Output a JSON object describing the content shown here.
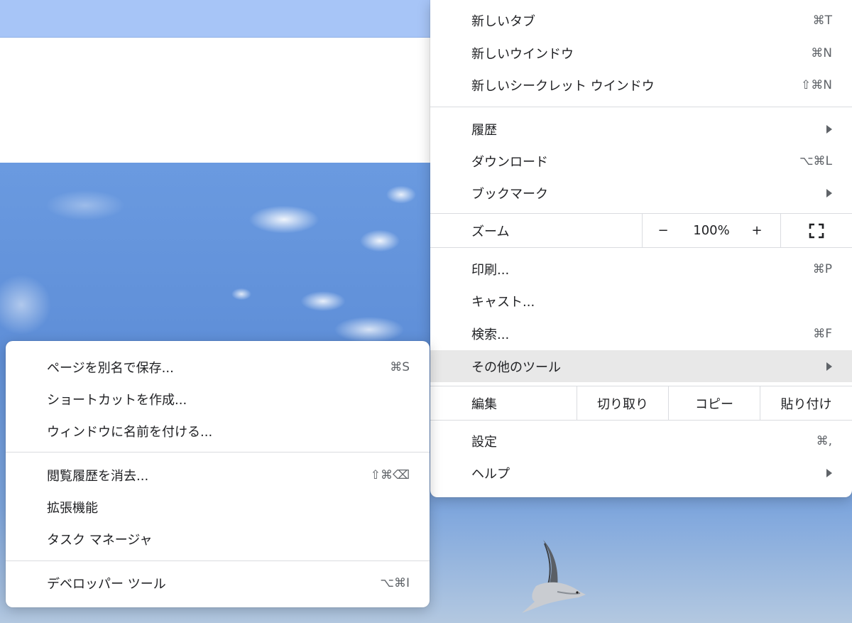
{
  "main_menu": {
    "items": [
      {
        "label": "新しいタブ",
        "shortcut": "⌘T"
      },
      {
        "label": "新しいウインドウ",
        "shortcut": "⌘N"
      },
      {
        "label": "新しいシークレット ウインドウ",
        "shortcut": "⇧⌘N"
      },
      {
        "label": "履歴",
        "shortcut": ""
      },
      {
        "label": "ダウンロード",
        "shortcut": "⌥⌘L"
      },
      {
        "label": "ブックマーク",
        "shortcut": ""
      },
      {
        "label": "印刷...",
        "shortcut": "⌘P"
      },
      {
        "label": "キャスト...",
        "shortcut": ""
      },
      {
        "label": "検索...",
        "shortcut": "⌘F"
      },
      {
        "label": "その他のツール",
        "shortcut": ""
      },
      {
        "label": "設定",
        "shortcut": "⌘,"
      },
      {
        "label": "ヘルプ",
        "shortcut": ""
      }
    ],
    "zoom": {
      "label": "ズーム",
      "minus": "−",
      "value": "100%",
      "plus": "+",
      "fullscreen_icon": "fullscreen-icon"
    },
    "edit": {
      "label": "編集",
      "cut": "切り取り",
      "copy": "コピー",
      "paste": "貼り付け"
    }
  },
  "sub_menu": {
    "items": [
      {
        "label": "ページを別名で保存...",
        "shortcut": "⌘S"
      },
      {
        "label": "ショートカットを作成...",
        "shortcut": ""
      },
      {
        "label": "ウィンドウに名前を付ける...",
        "shortcut": ""
      },
      {
        "label": "閲覧履歴を消去...",
        "shortcut": "⇧⌘⌫"
      },
      {
        "label": "拡張機能",
        "shortcut": ""
      },
      {
        "label": "タスク マネージャ",
        "shortcut": ""
      },
      {
        "label": "デベロッパー ツール",
        "shortcut": "⌥⌘I"
      }
    ]
  },
  "colors": {
    "menu_bg": "#ffffff",
    "hover_bg": "#e8e8e8",
    "separator": "#dadce0",
    "tabstrip": "#a7c5f7"
  }
}
